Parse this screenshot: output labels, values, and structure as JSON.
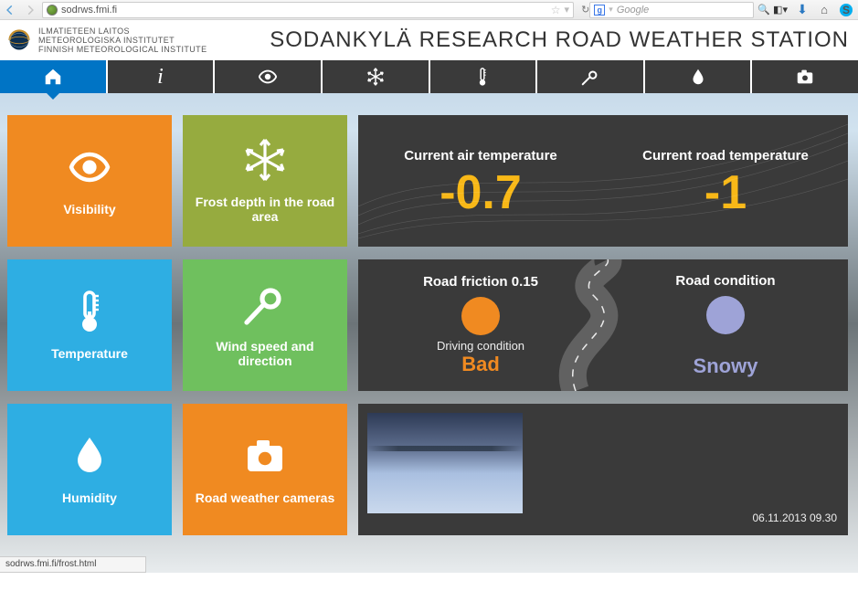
{
  "browser": {
    "url": "sodrws.fmi.fi",
    "search_placeholder": "Google",
    "status_text": "sodrws.fmi.fi/frost.html"
  },
  "header": {
    "org_line1": "ILMATIETEEN LAITOS",
    "org_line2": "METEOROLOGISKA INSTITUTET",
    "org_line3": "FINNISH METEOROLOGICAL INSTITUTE",
    "title": "SODANKYLÄ RESEARCH ROAD WEATHER STATION"
  },
  "tiles": {
    "visibility": "Visibility",
    "frost": "Frost depth in the road area",
    "temperature": "Temperature",
    "wind": "Wind speed and direction",
    "humidity": "Humidity",
    "cameras": "Road weather cameras"
  },
  "temp_panel": {
    "air_label": "Current air temperature",
    "air_value": "-0.7",
    "road_label": "Current road temperature",
    "road_value": "-1"
  },
  "cond_panel": {
    "friction_label": "Road friction 0.15",
    "driving_label": "Driving condition",
    "driving_value": "Bad",
    "condition_label": "Road condition",
    "condition_value": "Snowy"
  },
  "camera": {
    "timestamp": "06.11.2013 09.30"
  }
}
